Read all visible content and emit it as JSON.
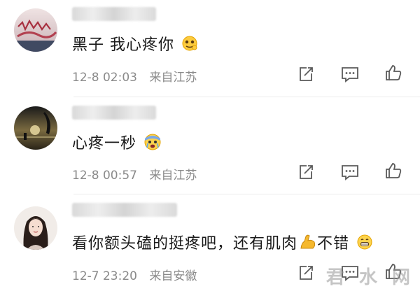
{
  "comments": [
    {
      "text": "黑子 我心疼你",
      "emoji": "thinking-pleading-emoji",
      "time": "12-8 02:03",
      "location": "来自江苏"
    },
    {
      "text": "心疼一秒",
      "emoji": "scared-crying-emoji",
      "time": "12-8 00:57",
      "location": "来自江苏"
    },
    {
      "text": "看你额头磕的挺疼吧，还有肌肉",
      "emoji": "flexed-biceps-emoji",
      "text_tail": "不错",
      "emoji_tail": "grinning-emoji",
      "time": "12-7 23:20",
      "location": "来自安徽"
    }
  ],
  "watermark": "君 水 网",
  "colors": {
    "meta_text": "#8a8a8a",
    "icon_stroke": "#5a5a5a",
    "divider": "#ececec"
  },
  "icons": [
    "share-icon",
    "comment-icon",
    "like-icon"
  ]
}
